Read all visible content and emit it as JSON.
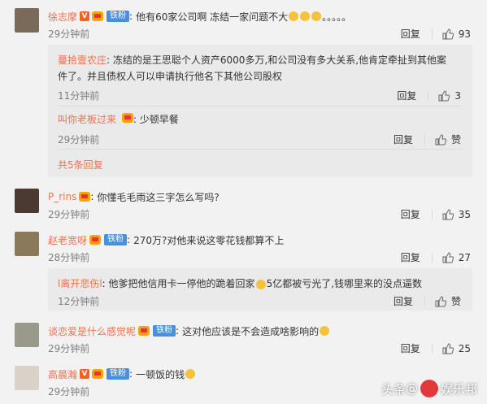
{
  "comments": [
    {
      "name": "徐志摩",
      "vip": "V",
      "fan": "铁粉",
      "text": "他有60家公司啊 冻结一家问题不大",
      "dots": "。。。。。",
      "time": "29分钟前",
      "reply": "回复",
      "likes": "93"
    },
    {
      "name": "P_rins",
      "text": "你懂毛毛雨这三字怎么写吗?",
      "time": "29分钟前",
      "reply": "回复",
      "likes": "35"
    },
    {
      "name": "赵老宽呀",
      "fan": "铁粉",
      "text": "270万?对他来说这零花钱都算不上",
      "time": "28分钟前",
      "reply": "回复",
      "likes": "27"
    },
    {
      "name": "谈恋爱是什么感觉呢",
      "fan": "铁粉",
      "text": "这对他应该是不会造成啥影响的",
      "time": "29分钟前",
      "reply": "回复",
      "likes": "25"
    },
    {
      "name": "高晨瀚",
      "vip": "V",
      "fan": "铁粉",
      "text": "一顿饭的钱",
      "time": "29分钟前",
      "reply": "回复",
      "likes": "赞"
    }
  ],
  "subreplies_1": [
    {
      "name": "蔓拾壹农庄",
      "text_line1": "冻结的是王思聪个人资产6000多万,和公司没有多大关系,他肯定牵扯到其他案",
      "text_line2": "件了。并且债权人可以申请执行他名下其他公司股权",
      "time": "11分钟前",
      "reply": "回复",
      "likes": "3"
    },
    {
      "name": "叫你老板过来",
      "text": "少顿早餐",
      "time": "29分钟前",
      "reply": "回复",
      "likes": "赞"
    }
  ],
  "more_replies": "共5条回复",
  "subreplies_3": [
    {
      "name": "l离开悲伤l",
      "text_a": "他爹把他信用卡一停他的跪着回家",
      "text_b": "5亿都被亏光了,钱哪里来的没点逼数",
      "time": "12分钟前",
      "reply": "回复",
      "likes": "赞"
    }
  ],
  "watermark": {
    "prefix": "头条",
    "at": "@",
    "brand": "娱乐邦"
  },
  "colors": {
    "accent": "#eb7350",
    "fan_badge": "#4a90d9",
    "background": "#f2f2f2",
    "subreply_bg": "#eaeaea"
  }
}
